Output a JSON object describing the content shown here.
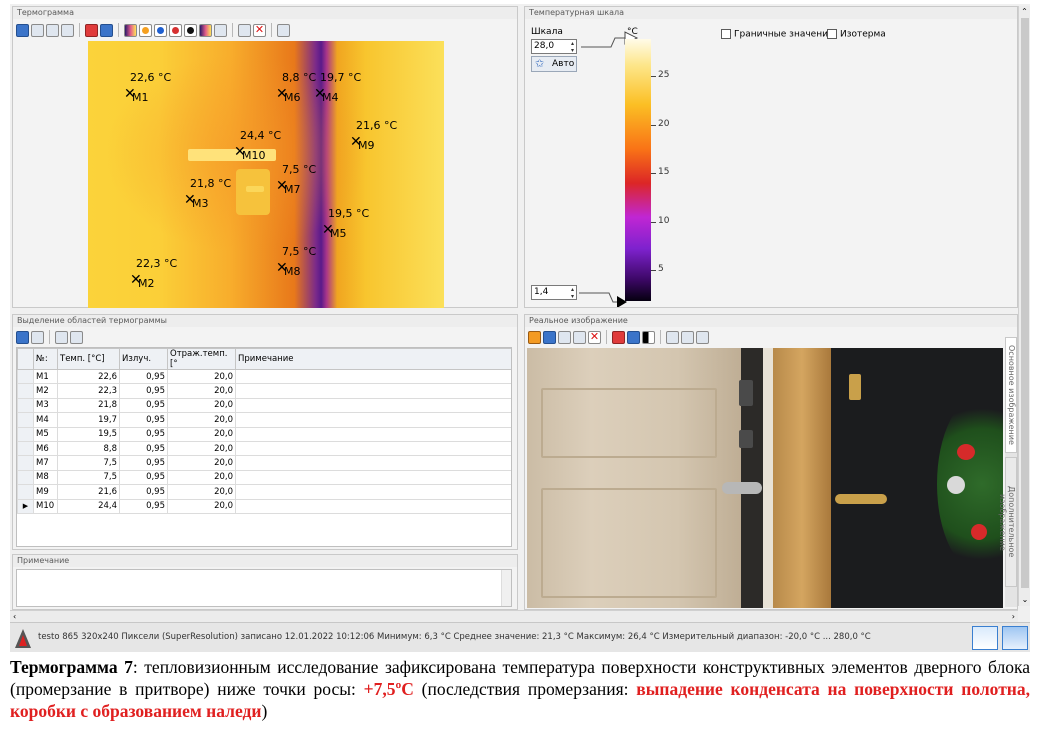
{
  "thermogram_panel": {
    "title": "Термограмма",
    "markers": [
      {
        "id": "M1",
        "value": "22,6 °C"
      },
      {
        "id": "M2",
        "value": "22,3 °C"
      },
      {
        "id": "M3",
        "value": "21,8 °C"
      },
      {
        "id": "M4",
        "value": "19,7 °C"
      },
      {
        "id": "M5",
        "value": "19,5 °C"
      },
      {
        "id": "M6",
        "value": "8,8 °C"
      },
      {
        "id": "M7",
        "value": "7,5 °C"
      },
      {
        "id": "M8",
        "value": "7,5 °C"
      },
      {
        "id": "M9",
        "value": "21,6 °C"
      },
      {
        "id": "M10",
        "value": "24,4 °C"
      }
    ]
  },
  "scale_panel": {
    "title": "Температурная шкала",
    "scale_label": "Шкала",
    "max_value": "28,0",
    "min_value": "1,4",
    "auto_button": "Авто",
    "unit": "°C",
    "ticks": [
      "25",
      "20",
      "15",
      "10",
      "5"
    ],
    "checkbox_limits": "Граничные значения",
    "checkbox_isotherm": "Изотерма"
  },
  "areas_panel": {
    "title": "Выделение областей термограммы",
    "columns": [
      "№:",
      "Темп. [°C]",
      "Излуч.",
      "Отраж.темп. [°",
      "Примечание"
    ],
    "rows": [
      [
        "M1",
        "22,6",
        "0,95",
        "20,0",
        ""
      ],
      [
        "M2",
        "22,3",
        "0,95",
        "20,0",
        ""
      ],
      [
        "M3",
        "21,8",
        "0,95",
        "20,0",
        ""
      ],
      [
        "M4",
        "19,7",
        "0,95",
        "20,0",
        ""
      ],
      [
        "M5",
        "19,5",
        "0,95",
        "20,0",
        ""
      ],
      [
        "M6",
        "8,8",
        "0,95",
        "20,0",
        ""
      ],
      [
        "M7",
        "7,5",
        "0,95",
        "20,0",
        ""
      ],
      [
        "M8",
        "7,5",
        "0,95",
        "20,0",
        ""
      ],
      [
        "M9",
        "21,6",
        "0,95",
        "20,0",
        ""
      ],
      [
        "M10",
        "24,4",
        "0,95",
        "20,0",
        ""
      ]
    ]
  },
  "note_panel": {
    "title": "Примечание"
  },
  "real_image_panel": {
    "title": "Реальное изображение",
    "side_tab_1": "Основное изображение",
    "side_tab_2": "Дополнительное изображение"
  },
  "status": {
    "text": "testo 865 320x240 Пиксели (SuperResolution) записано 12.01.2022 10:12:06 Минимум: 6,3 °C Среднее значение: 21,3 °C Максимум: 26,4 °C Измерительный диапазон: -20,0 °C ... 280,0 °C"
  },
  "caption": {
    "part1": "Термограмма  7",
    "part2": ": тепловизионным исследование зафиксирована температура поверхности конструктивных элементов дверного блока (промерзание в притворе) ниже точки росы: ",
    "part3": "+7,5ºC",
    "part4": " (последствия промерзания: ",
    "part5": "выпадение конденсата на поверхности полотна, коробки с образованием наледи",
    "part6": ")"
  }
}
